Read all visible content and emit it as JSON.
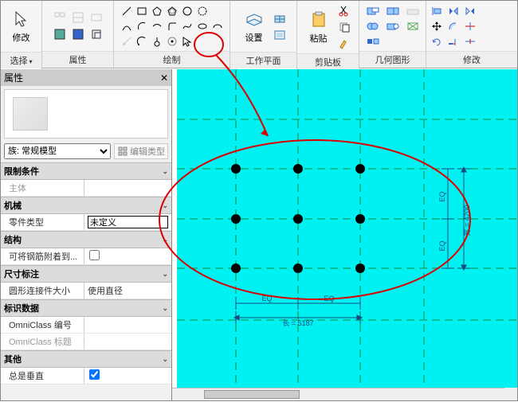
{
  "ribbon": {
    "select": {
      "modify": "修改",
      "label": "选择"
    },
    "properties": {
      "label": "属性"
    },
    "draw": {
      "label": "绘制"
    },
    "workplane": {
      "set": "设置",
      "label": "工作平面"
    },
    "clipboard": {
      "paste": "粘贴",
      "label": "剪贴板"
    },
    "geometry": {
      "label": "几何图形"
    },
    "modify2": {
      "label": "修改"
    }
  },
  "props": {
    "title": "属性",
    "family_label": "族: 常规模型",
    "edit_type": "编辑类型",
    "groups": {
      "constraints": "限制条件",
      "host": "主体",
      "mech": "机械",
      "part_type_k": "零件类型",
      "part_type_v": "未定义",
      "struct": "结构",
      "rebar_k": "可将钢筋附着到...",
      "dim": "尺寸标注",
      "round_conn_k": "圆形连接件大小",
      "round_conn_v": "使用直径",
      "identity": "标识数据",
      "omni_num": "OmniClass 编号",
      "omni_title": "OmniClass 标题",
      "other": "其他",
      "always_vert": "总是垂直"
    }
  },
  "canvas": {
    "eq": "EQ",
    "len_label": "长 = 5187",
    "width_label": "宽 = 4200"
  }
}
